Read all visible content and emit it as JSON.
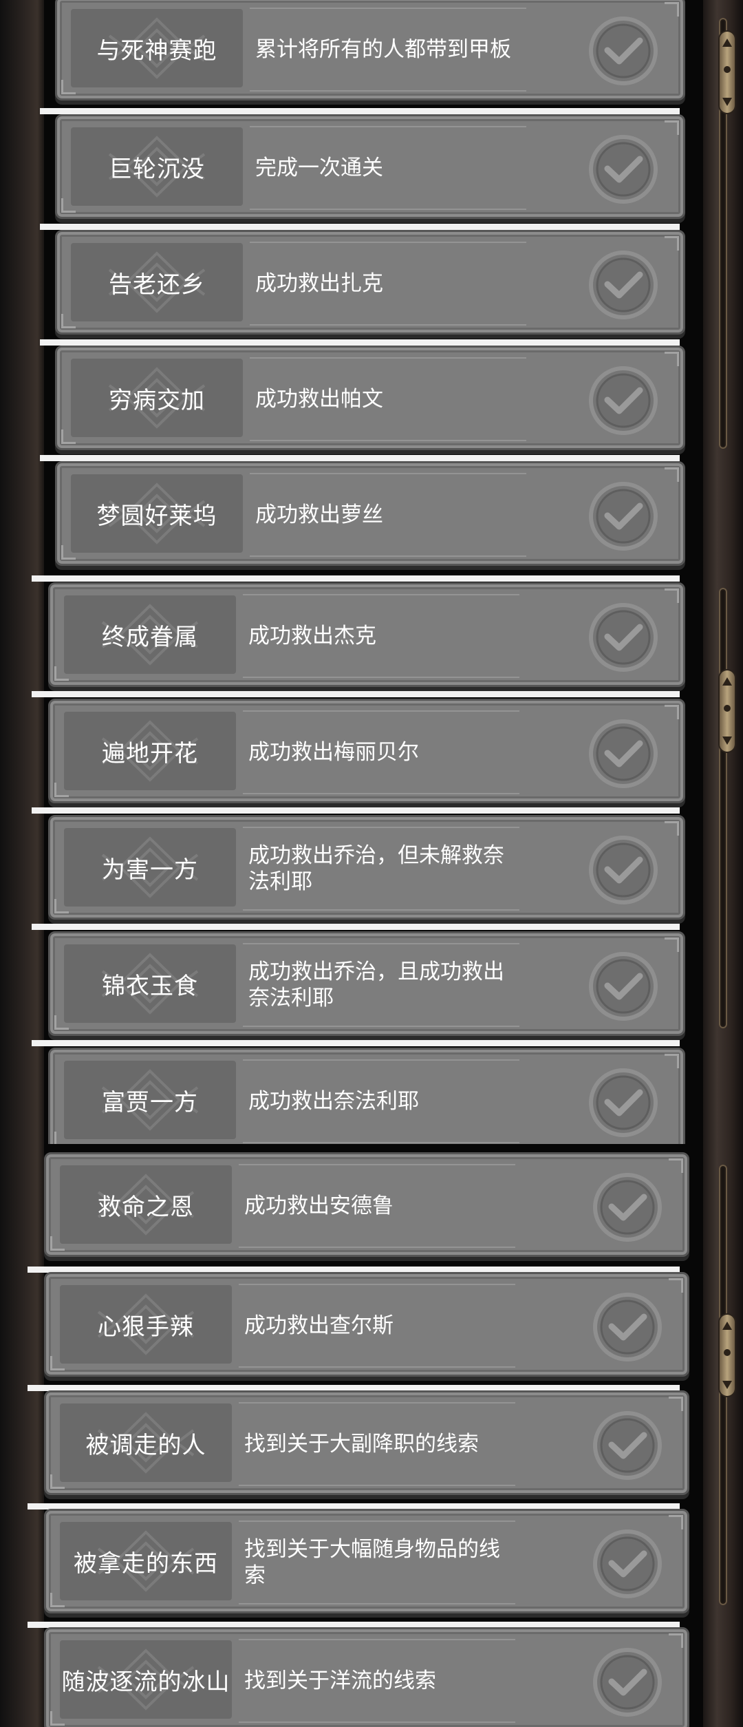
{
  "achievements": [
    {
      "title": "与死神赛跑",
      "desc": "累计将所有的人都带到甲板"
    },
    {
      "title": "巨轮沉没",
      "desc": "完成一次通关"
    },
    {
      "title": "告老还乡",
      "desc": "成功救出扎克"
    },
    {
      "title": "穷病交加",
      "desc": "成功救出帕文"
    },
    {
      "title": "梦圆好莱坞",
      "desc": "成功救出萝丝"
    },
    {
      "title": "终成眷属",
      "desc": "成功救出杰克"
    },
    {
      "title": "遍地开花",
      "desc": "成功救出梅丽贝尔"
    },
    {
      "title": "为害一方",
      "desc": "成功救出乔治，但未解救奈法利耶"
    },
    {
      "title": "锦衣玉食",
      "desc": "成功救出乔治，且成功救出奈法利耶"
    },
    {
      "title": "富贾一方",
      "desc": "成功救出奈法利耶"
    },
    {
      "title": "救命之恩",
      "desc": "成功救出安德鲁"
    },
    {
      "title": "心狠手辣",
      "desc": "成功救出查尔斯"
    },
    {
      "title": "被调走的人",
      "desc": "找到关于大副降职的线索"
    },
    {
      "title": "被拿走的东西",
      "desc": "找到关于大幅随身物品的线索"
    },
    {
      "title": "随波逐流的冰山",
      "desc": "找到关于洋流的线索"
    }
  ],
  "icons": {
    "check": "check-circle-icon",
    "emblem": "emblem-icon",
    "scroll_arrows": "scroll-arrows-icon"
  },
  "colors": {
    "card": "#7d7d7d",
    "text": "#ffffff",
    "separator": "#f2f2f2"
  }
}
